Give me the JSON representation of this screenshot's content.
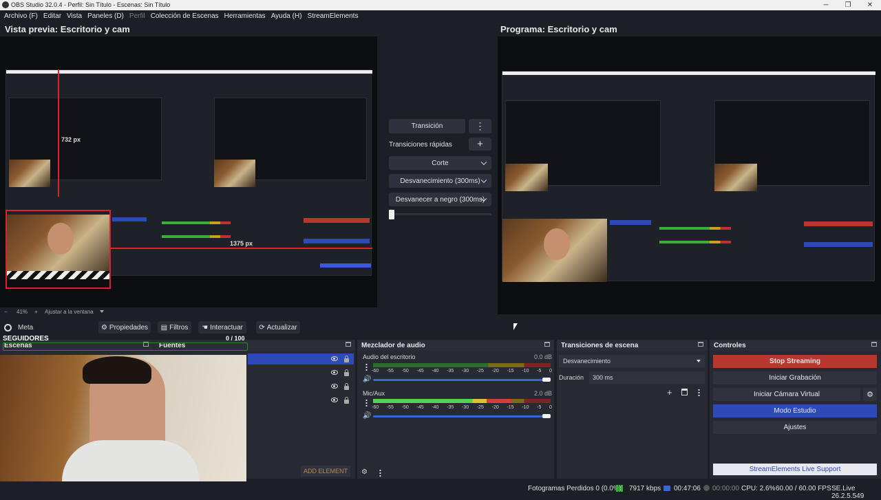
{
  "window": {
    "title": "OBS Studio 32.0.4 - Perfil: Sin Título - Escenas: Sin Título",
    "minimize": "─",
    "maximize": "❐",
    "close": "✕"
  },
  "menu": [
    "Archivo (F)",
    "Editar",
    "Vista",
    "Paneles (D)",
    "Perfil",
    "Colección de Escenas",
    "Herramientas",
    "Ayuda (H)",
    "StreamElements"
  ],
  "preview": {
    "title": "Vista previa: Escritorio y cam",
    "width_label": "732 px",
    "length_label": "1375 px",
    "zoom_minus": "−",
    "zoom": "41%",
    "zoom_plus": "+",
    "fit": "Ajustar a la ventana"
  },
  "program": {
    "title": "Programa: Escritorio y cam"
  },
  "transitions_center": {
    "transition_label": "Transición",
    "quick_label": "Transiciones rápidas",
    "add": "+",
    "items": [
      "Corte",
      "Desvanecimiento (300ms)",
      "Desvanecer a negro (300ms)"
    ]
  },
  "source_toolbar": {
    "source_name": "Meta",
    "properties": "Propiedades",
    "filters": "Filtros",
    "interact": "Interactuar",
    "refresh": "Actualizar"
  },
  "goal_overlay": {
    "label": "SEGUIDORES",
    "progress": "0  / 100"
  },
  "scenes": {
    "title": "Escenas"
  },
  "sources": {
    "title": "Fuentes",
    "add_element": "ADD ELEMENT"
  },
  "mixer": {
    "title": "Mezclador de audio",
    "tracks": [
      {
        "name": "Audio del escritorio",
        "db": "0.0 dB",
        "level": 0.0
      },
      {
        "name": "Mic/Aux",
        "db": "2.0 dB",
        "level": 0.78
      }
    ],
    "ticks": [
      "-60",
      "-55",
      "-50",
      "-45",
      "-40",
      "-35",
      "-30",
      "-25",
      "-20",
      "-15",
      "-10",
      "-5",
      "0"
    ]
  },
  "scene_transitions": {
    "title": "Transiciones de escena",
    "selected": "Desvanecimiento",
    "duration_label": "Duración",
    "duration_value": "300 ms"
  },
  "controls": {
    "title": "Controles",
    "stop_streaming": "Stop Streaming",
    "start_recording": "Iniciar Grabación",
    "virtual_cam": "Iniciar Cámara Virtual",
    "studio_mode": "Modo Estudio",
    "settings": "Ajustes",
    "se_support": "StreamElements Live Support"
  },
  "status": {
    "dropped_frames": "Fotogramas Perdidos 0 (0.0%)",
    "bitrate": "7917 kbps",
    "stream_time": "00:47:06",
    "rec_time": "00:00:00",
    "cpu": "CPU: 2.6%",
    "fps": "60.00 / 60.00 FPS",
    "version": "SE.Live 26.2.5.549"
  },
  "colors": {
    "accent_blue": "#2e4ab8",
    "stop_red": "#b8382e",
    "meter_green": "#55d255"
  }
}
